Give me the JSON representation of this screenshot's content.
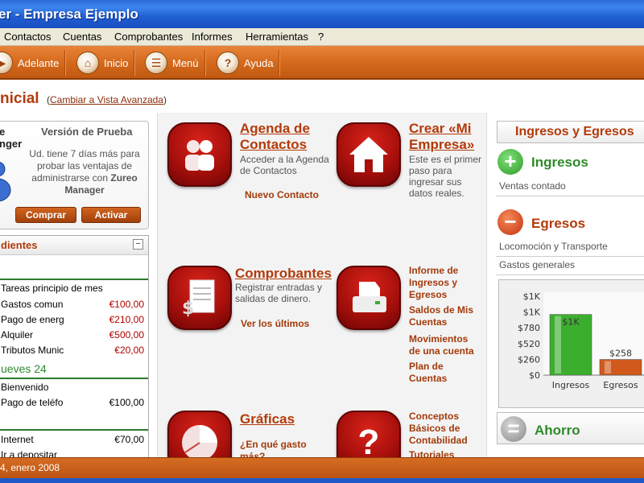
{
  "window": {
    "title": "er - Empresa Ejemplo"
  },
  "menu": [
    "Contactos",
    "Cuentas",
    "Comprobantes",
    "Informes",
    "Herramientas",
    "?"
  ],
  "toolbar": [
    {
      "label": "Adelante",
      "icon": "forward-arrow-icon"
    },
    {
      "label": "Inicio",
      "icon": "home-icon"
    },
    {
      "label": "Menú",
      "icon": "menu-list-icon"
    },
    {
      "label": "Ayuda",
      "icon": "help-icon"
    }
  ],
  "page": {
    "title": "nicial",
    "link": "Cambiar a Vista Avanzada",
    "link_open": "(",
    "link_close": ")"
  },
  "trial": {
    "logo_line1": "e",
    "logo_line2": "nger",
    "title": "Versión de Prueba",
    "text_pre": "Ud. tiene 7 días más para probar las ventajas de administrarse con",
    "brand": "Zureo Manager",
    "buy": "Comprar",
    "activate": "Activar"
  },
  "pending": {
    "title": "dientes",
    "collapse": "−",
    "rows": [
      {
        "label": "Tareas principio de mes",
        "amount": ""
      },
      {
        "label": "Gastos comun",
        "amount": "€100,00"
      },
      {
        "label": "Pago de energ",
        "amount": "€210,00"
      },
      {
        "label": "Alquiler",
        "amount": "€500,00"
      },
      {
        "label": "Tributos Munic",
        "amount": "€20,00"
      }
    ],
    "day": "ueves 24",
    "rows2": [
      {
        "label": "Bienvenido",
        "amount": ""
      },
      {
        "label": "Pago de teléfo",
        "amount": "€100,00"
      }
    ],
    "rows3": [
      {
        "label": "Internet",
        "amount": "€70,00"
      },
      {
        "label": "Ir a depositar",
        "amount": ""
      }
    ]
  },
  "center": {
    "agenda": {
      "title1": "Agenda de",
      "title2": "Contactos",
      "desc1": "Acceder a la Agenda",
      "desc2": "de Contactos",
      "link": "Nuevo Contacto"
    },
    "empresa": {
      "title1": "Crear «Mi",
      "title2": "Empresa»",
      "desc": [
        "Este es el primer",
        "paso para",
        "ingresar sus",
        "datos reales."
      ]
    },
    "comprobantes": {
      "title": "Comprobantes",
      "desc1": "Registrar entradas y",
      "desc2": "salidas de dinero.",
      "link": "Ver los últimos"
    },
    "informes": {
      "links": [
        "Informe de",
        "Ingresos y",
        "Egresos",
        "Saldos de Mis",
        "Cuentas",
        "Movimientos",
        "de una cuenta",
        "Plan de",
        "Cuentas"
      ]
    },
    "graficas": {
      "title": "Gráficas",
      "link1": "¿En qué gasto",
      "link2": "más?"
    },
    "ayuda": {
      "links": [
        "Conceptos",
        "Básicos de",
        "Contabilidad",
        "Tutoriales"
      ]
    }
  },
  "right": {
    "header": "Ingresos y Egresos",
    "ingresos": {
      "label": "Ingresos",
      "items": [
        "Ventas contado"
      ]
    },
    "egresos": {
      "label": "Egresos",
      "items": [
        "Locomoción y Transporte",
        "Gastos generales"
      ]
    },
    "ahorro": {
      "label": "Ahorro"
    }
  },
  "chart_data": {
    "type": "bar",
    "categories": [
      "Ingresos",
      "Egresos"
    ],
    "values": [
      1000,
      258
    ],
    "data_labels": [
      "$1K",
      "$258"
    ],
    "ytick_labels": [
      "$1K",
      "$1K",
      "$780",
      "$520",
      "$260",
      "$0"
    ],
    "ylim": [
      0,
      1300
    ],
    "colors": [
      "#3cae2e",
      "#d2591c"
    ],
    "grid": false
  },
  "status": {
    "text": "4, enero 2008"
  }
}
